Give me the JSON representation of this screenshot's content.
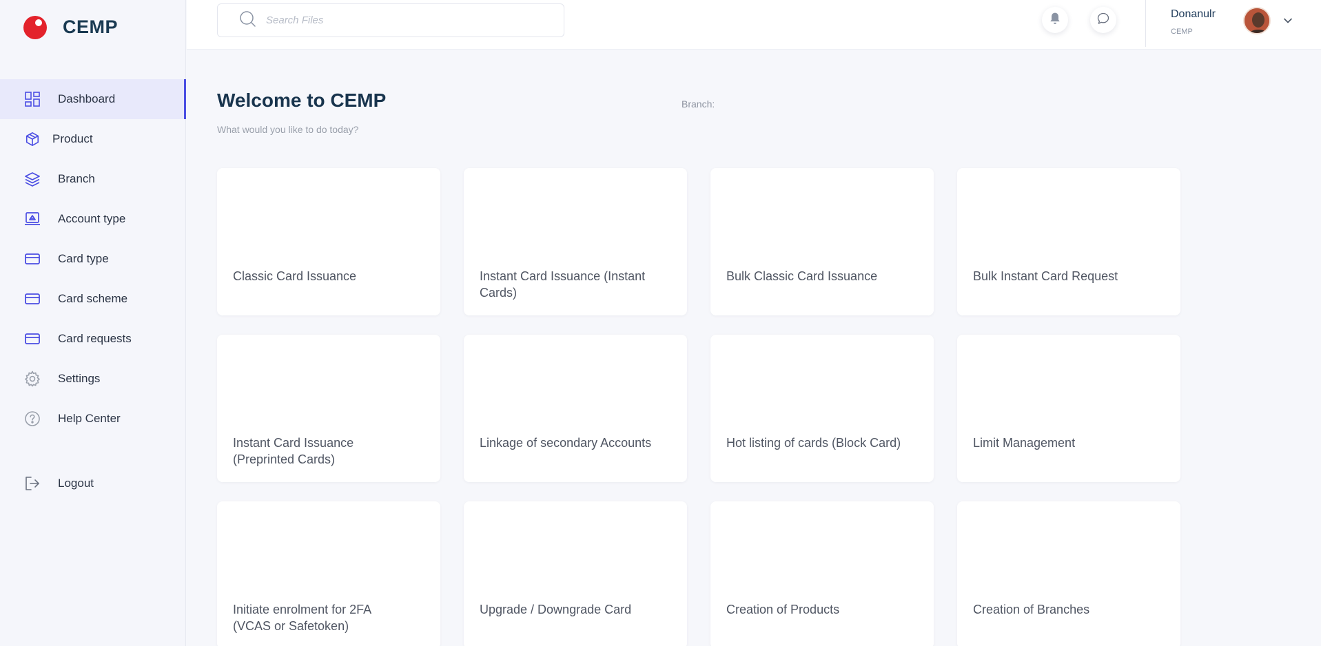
{
  "brand": {
    "name": "CEMP"
  },
  "sidebar": {
    "items": [
      {
        "label": "Dashboard",
        "icon": "dashboard-icon"
      },
      {
        "label": "Product",
        "icon": "cube-icon"
      },
      {
        "label": "Branch",
        "icon": "layers-icon"
      },
      {
        "label": "Account type",
        "icon": "laptop-icon"
      },
      {
        "label": "Card type",
        "icon": "card-icon"
      },
      {
        "label": "Card scheme",
        "icon": "card-icon"
      },
      {
        "label": "Card requests",
        "icon": "card-icon"
      },
      {
        "label": "Settings",
        "icon": "gear-icon"
      },
      {
        "label": "Help Center",
        "icon": "help-icon"
      }
    ],
    "logout_label": "Logout",
    "active_index": 0
  },
  "topbar": {
    "search_placeholder": "Search Files",
    "user_name": "Donanulr",
    "user_org": "CEMP"
  },
  "main": {
    "title": "Welcome to CEMP",
    "subtitle": "What would you like to do today?",
    "branch_label": "Branch:",
    "cards": [
      "Classic Card Issuance",
      "Instant Card Issuance (Instant Cards)",
      "Bulk Classic Card Issuance",
      "Bulk Instant Card Request",
      "Instant Card Issuance (Preprinted Cards)",
      "Linkage of secondary Accounts",
      "Hot listing of cards (Block Card)",
      "Limit Management",
      "Initiate enrolment for 2FA (VCAS or Safetoken)",
      "Upgrade / Downgrade Card",
      "Creation of Products",
      "Creation of Branches"
    ]
  },
  "colors": {
    "accent": "#4b4ee3",
    "brand_red": "#e3222b",
    "title": "#18344d",
    "background": "#f6f7fb"
  }
}
